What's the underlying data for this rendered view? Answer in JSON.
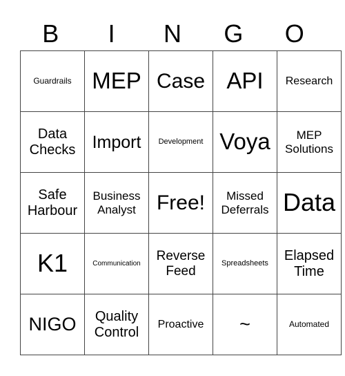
{
  "header": {
    "letters": [
      "B",
      "I",
      "N",
      "G",
      "O"
    ]
  },
  "board": {
    "rows": [
      [
        "Guardrails",
        "MEP",
        "Case",
        "API",
        "Research"
      ],
      [
        "Data Checks",
        "Import",
        "Development",
        "Voya",
        "MEP Solutions"
      ],
      [
        "Safe Harbour",
        "Business Analyst",
        "Free!",
        "Missed Deferrals",
        "Data"
      ],
      [
        "K1",
        "Communication",
        "Reverse Feed",
        "Spreadsheets",
        "Elapsed Time"
      ],
      [
        "NIGO",
        "Quality Control",
        "Proactive",
        "~",
        "Automated"
      ]
    ]
  }
}
